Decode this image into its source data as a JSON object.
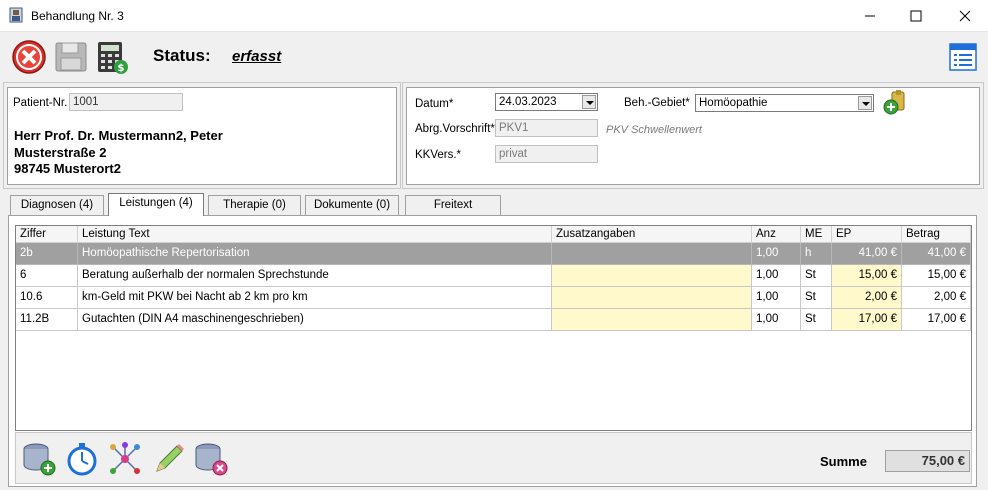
{
  "window": {
    "title": "Behandlung Nr. 3"
  },
  "toolbar": {
    "status_label": "Status:",
    "status_value": "erfasst"
  },
  "patient": {
    "nr_label": "Patient-Nr.",
    "nr_value": "1001",
    "name": "Herr Prof. Dr. Mustermann2, Peter",
    "street": "Musterstraße 2",
    "city": "98745 Musterort2"
  },
  "details": {
    "datum_label": "Datum*",
    "datum_value": "24.03.2023",
    "gebiet_label": "Beh.-Gebiet*",
    "gebiet_value": "Homöopathie",
    "abrg_label": "Abrg.Vorschrift*",
    "abrg_value": "PKV1",
    "abrg_hint": "PKV Schwellenwert",
    "kkvers_label": "KKVers.*",
    "kkvers_value": "privat"
  },
  "tabs": [
    {
      "label": "Diagnosen (4)"
    },
    {
      "label": "Leistungen (4)"
    },
    {
      "label": "Therapie (0)"
    },
    {
      "label": "Dokumente (0)"
    },
    {
      "label": "Freitext"
    }
  ],
  "grid": {
    "columns": [
      "Ziffer",
      "Leistung Text",
      "Zusatzangaben",
      "Anz",
      "ME",
      "EP",
      "Betrag"
    ],
    "rows": [
      {
        "ziffer": "2b",
        "text": "Homöopathische Repertorisation",
        "zusatz": "",
        "anz": "1,00",
        "me": "h",
        "ep": "41,00 €",
        "betrag": "41,00 €"
      },
      {
        "ziffer": "6",
        "text": "Beratung außerhalb der normalen Sprechstunde",
        "zusatz": "",
        "anz": "1,00",
        "me": "St",
        "ep": "15,00 €",
        "betrag": "15,00 €"
      },
      {
        "ziffer": "10.6",
        "text": "km-Geld mit PKW bei Nacht ab 2 km pro km",
        "zusatz": "",
        "anz": "1,00",
        "me": "St",
        "ep": "2,00 €",
        "betrag": "2,00 €"
      },
      {
        "ziffer": "11.2B",
        "text": "Gutachten (DIN A4 maschinengeschrieben)",
        "zusatz": "",
        "anz": "1,00",
        "me": "St",
        "ep": "17,00 €",
        "betrag": "17,00 €"
      }
    ]
  },
  "summary": {
    "summe_label": "Summe",
    "summe_value": "75,00 €"
  },
  "colors": {
    "accent": "#1e6fd9",
    "selected_row": "#a0a0a0",
    "editable_cell": "#fff9cc"
  },
  "icons": [
    "cancel-icon",
    "save-icon",
    "calculator-icon",
    "list-view-icon",
    "add-area-icon",
    "database-add-icon",
    "stopwatch-icon",
    "network-icon",
    "pencil-icon",
    "database-delete-icon"
  ]
}
